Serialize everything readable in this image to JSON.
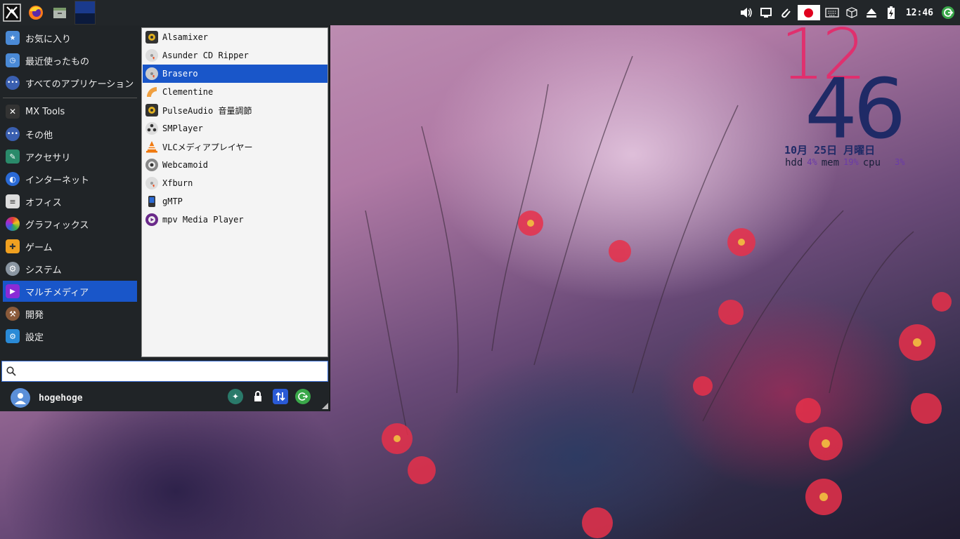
{
  "panel": {
    "clock": "12:46"
  },
  "menu": {
    "categories": [
      {
        "label": "お気に入り",
        "icon": "favorites-folder-icon",
        "color": "#4a8ad6"
      },
      {
        "label": "最近使ったもの",
        "icon": "recent-folder-icon",
        "color": "#4a8ad6"
      },
      {
        "label": "すべてのアプリケーション",
        "icon": "all-apps-icon",
        "color": "#3a5fb0"
      },
      {
        "label": "MX Tools",
        "icon": "mx-tools-icon",
        "color": "#333333"
      },
      {
        "label": "その他",
        "icon": "other-icon",
        "color": "#3a5fb0"
      },
      {
        "label": "アクセサリ",
        "icon": "accessories-icon",
        "color": "#2a8a6a"
      },
      {
        "label": "インターネット",
        "icon": "internet-icon",
        "color": "#2a6ad6"
      },
      {
        "label": "オフィス",
        "icon": "office-icon",
        "color": "#dddddd"
      },
      {
        "label": "グラフィックス",
        "icon": "graphics-icon",
        "color": "#e07a2a"
      },
      {
        "label": "ゲーム",
        "icon": "games-icon",
        "color": "#f0a020"
      },
      {
        "label": "システム",
        "icon": "system-icon",
        "color": "#8a96a2"
      },
      {
        "label": "マルチメディア",
        "icon": "multimedia-icon",
        "color": "#8a2ad6"
      },
      {
        "label": "開発",
        "icon": "development-icon",
        "color": "#8a5a3a"
      },
      {
        "label": "設定",
        "icon": "settings-icon",
        "color": "#2a8ad6"
      }
    ],
    "selected_category": "マルチメディア",
    "apps": [
      {
        "label": "Alsamixer",
        "icon": "alsamixer-icon",
        "color": "#333333"
      },
      {
        "label": "Asunder CD Ripper",
        "icon": "asunder-icon",
        "color": "#dddddd"
      },
      {
        "label": "Brasero",
        "icon": "brasero-icon",
        "color": "#cccccc"
      },
      {
        "label": "Clementine",
        "icon": "clementine-icon",
        "color": "#f0a040"
      },
      {
        "label": "PulseAudio 音量調節",
        "icon": "pulseaudio-icon",
        "color": "#333333"
      },
      {
        "label": "SMPlayer",
        "icon": "smplayer-icon",
        "color": "#dddddd"
      },
      {
        "label": "VLCメディアプレイヤー",
        "icon": "vlc-icon",
        "color": "#f07a10"
      },
      {
        "label": "Webcamoid",
        "icon": "webcamoid-icon",
        "color": "#888888"
      },
      {
        "label": "Xfburn",
        "icon": "xfburn-icon",
        "color": "#dddddd"
      },
      {
        "label": "gMTP",
        "icon": "gmtp-icon",
        "color": "#2a6ad6"
      },
      {
        "label": "mpv Media Player",
        "icon": "mpv-icon",
        "color": "#6a2a8a"
      }
    ],
    "selected_app": "Brasero",
    "search": {
      "value": "",
      "placeholder": ""
    },
    "user": {
      "name": "hogehoge"
    }
  },
  "conky": {
    "hour": "12",
    "minute": "46",
    "date": "10月 25日 月曜日",
    "stats": [
      {
        "label": "hdd",
        "value": "4%"
      },
      {
        "label": "mem",
        "value": "19%"
      },
      {
        "label": "cpu",
        "value": "3%"
      }
    ]
  }
}
